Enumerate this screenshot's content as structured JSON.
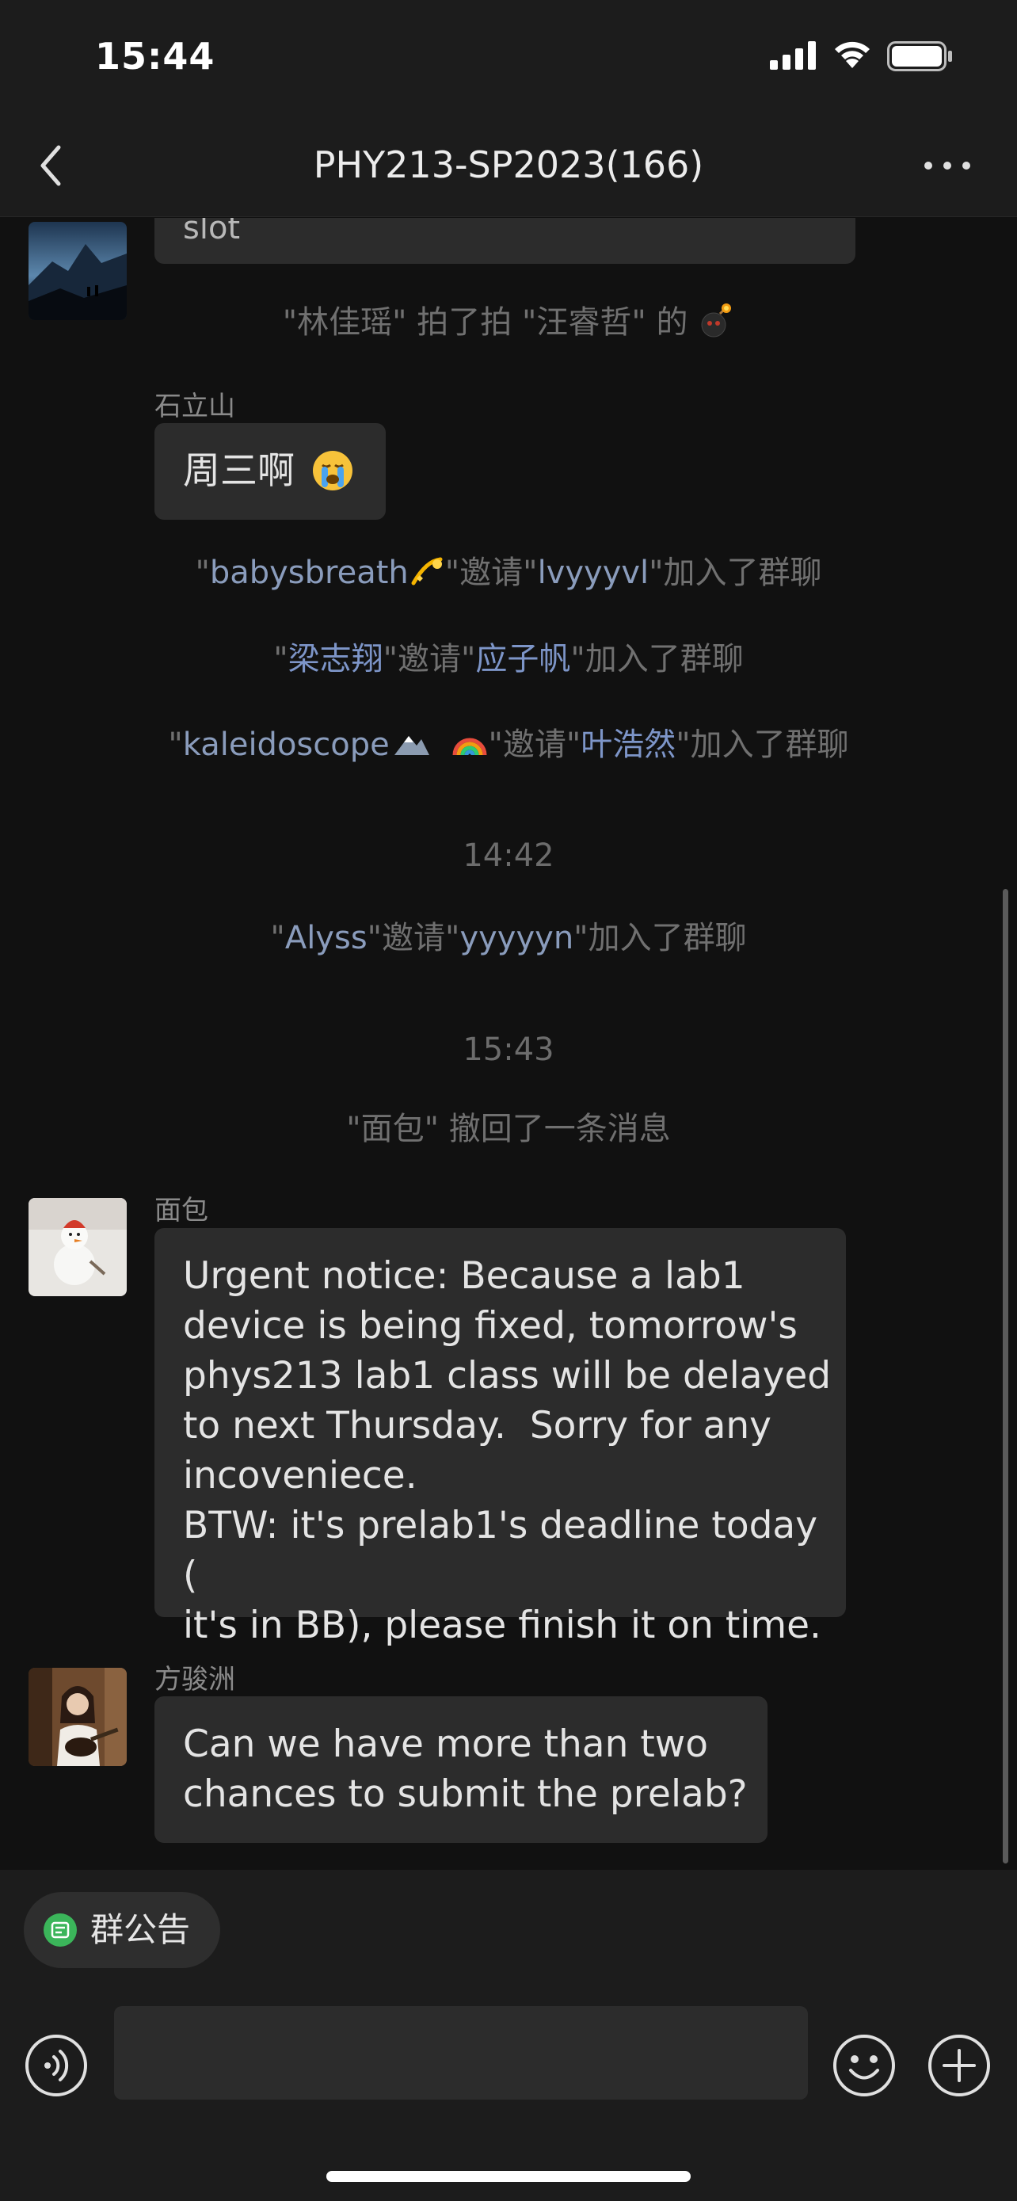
{
  "status_bar": {
    "time": "15:44"
  },
  "nav": {
    "title": "PHY213-SP2023(166)"
  },
  "chat": {
    "partial_message": "slot",
    "pat_notice": {
      "prefix": "\"林佳瑶\" 拍了拍 \"汪睿哲\" 的"
    },
    "msg_shilishan": {
      "sender": "石立山",
      "text": "周三啊"
    },
    "invite1": {
      "q1": "\"",
      "inviter": "babysbreath",
      "mid": "\"邀请\"",
      "invitee": "lvyyyvl",
      "end": "\"加入了群聊"
    },
    "invite2": {
      "q1": "\"",
      "inviter": "梁志翔",
      "mid": "\"邀请\"",
      "invitee": "应子帆",
      "end": "\"加入了群聊"
    },
    "invite3": {
      "q1": "\"",
      "inviter": "kaleidoscope",
      "mid": "\"邀请\"",
      "invitee": "叶浩然",
      "end": "\"加入了群聊"
    },
    "time1": "14:42",
    "invite4": {
      "q1": "\"",
      "inviter": "Alyss",
      "mid": "\"邀请\"",
      "invitee": "yyyyyn",
      "end": "\"加入了群聊"
    },
    "time2": "15:43",
    "recall_notice": "\"面包\" 撤回了一条消息",
    "msg_mianbao": {
      "sender": "面包",
      "text": "Urgent notice: Because a lab1\ndevice is being fixed, tomorrow's\nphys213 lab1 class will be delayed\nto next Thursday.  Sorry for any\nincoveniece.\nBTW: it's prelab1's deadline today (\nit's in BB), please finish it on time."
    },
    "msg_fangjunzhou": {
      "sender": "方骏洲",
      "text": "Can we have more than two\nchances to submit the prelab?"
    }
  },
  "bottom": {
    "announcement_label": "群公告",
    "input_value": ""
  },
  "colors": {
    "background": "#111111",
    "bar": "#1c1c1c",
    "bubble": "#2c2c2c",
    "name_link": "#8a9cbc",
    "announce_green": "#3bb55a"
  },
  "icons": [
    "back-icon",
    "more-icon",
    "signal-icon",
    "wifi-icon",
    "battery-icon",
    "bomb-emoji",
    "crying-emoji",
    "dizzy-emoji",
    "mountain-emoji",
    "rainbow-emoji",
    "announcement-icon",
    "voice-icon",
    "emoji-icon",
    "plus-icon"
  ]
}
